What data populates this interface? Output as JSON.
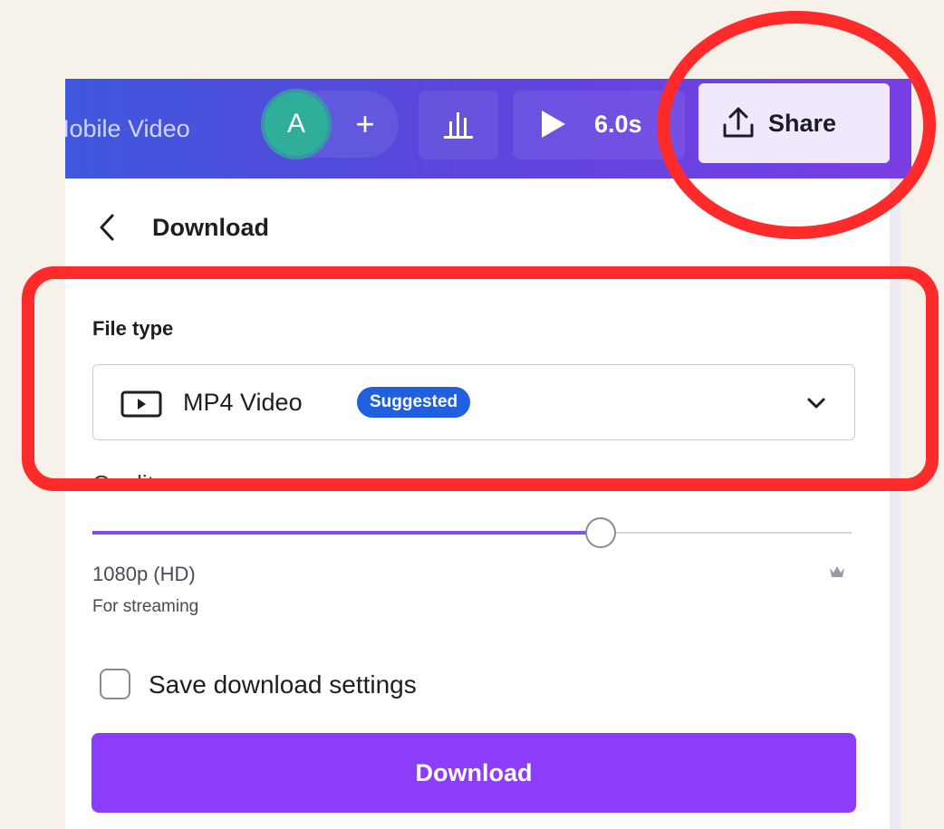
{
  "header": {
    "title": "Mobile Video",
    "avatar_initial": "A",
    "add_collaborator_label": "+",
    "duration": "6.0s",
    "share_label": "Share"
  },
  "panel": {
    "title": "Download",
    "file_type": {
      "label": "File type",
      "value": "MP4 Video",
      "badge": "Suggested"
    },
    "quality": {
      "label": "Quality",
      "slider_level": 0.67,
      "resolution": "1080p (HD)",
      "description": "For streaming"
    },
    "save_settings": {
      "label": "Save download settings",
      "checked": false
    },
    "download_button": "Download"
  },
  "icons": [
    "back-chevron-icon",
    "insights-icon",
    "play-icon",
    "upload-share-icon",
    "video-file-icon",
    "chevron-down-icon",
    "crown-icon"
  ],
  "colors": {
    "header_gradient_start": "#3f58dd",
    "header_gradient_end": "#7a3fe4",
    "primary_button": "#8b3dfa",
    "badge": "#1f5fe0",
    "annotation_red": "#ff2a2a",
    "slider_fill": "#7d4ee6"
  }
}
